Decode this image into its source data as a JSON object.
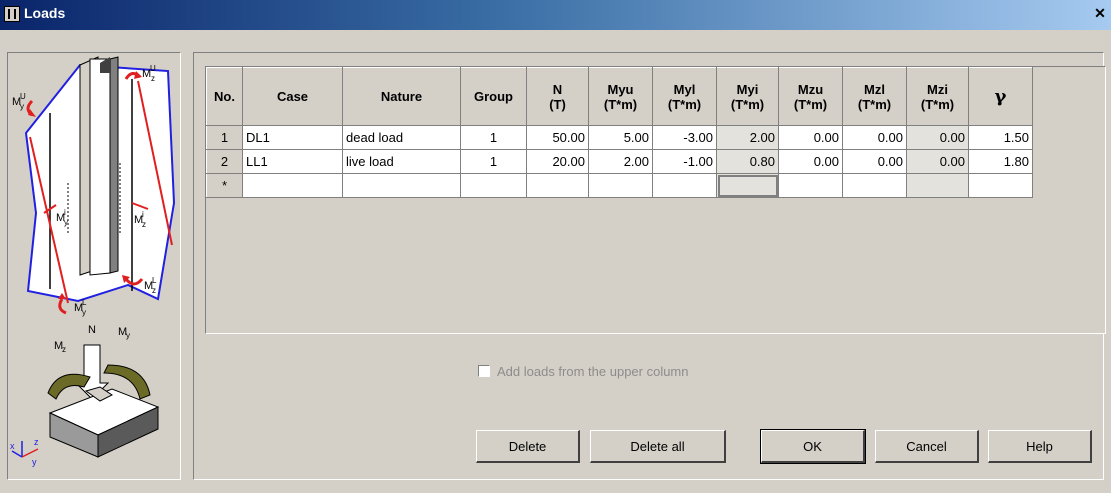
{
  "window": {
    "title": "Loads",
    "close_glyph": "✕"
  },
  "colors": {
    "titlebar_start": "#0a246a",
    "titlebar_end": "#a6caf0",
    "face": "#d4d0c8",
    "calc_cell": "#e4e2dc",
    "red_arrow": "#e02020",
    "figure_blue": "#2020e0"
  },
  "diagram": {
    "label_myu": "Mᵤʸ",
    "label_mzu": "M",
    "label_n": "N",
    "label_my": "My",
    "label_mz": "Mz"
  },
  "grid": {
    "headers": [
      {
        "line1": "No.",
        "line2": ""
      },
      {
        "line1": "Case",
        "line2": ""
      },
      {
        "line1": "Nature",
        "line2": ""
      },
      {
        "line1": "Group",
        "line2": ""
      },
      {
        "line1": "N",
        "line2": "(T)"
      },
      {
        "line1": "Myu",
        "line2": "(T*m)"
      },
      {
        "line1": "Myl",
        "line2": "(T*m)"
      },
      {
        "line1": "Myi",
        "line2": "(T*m)"
      },
      {
        "line1": "Mzu",
        "line2": "(T*m)"
      },
      {
        "line1": "Mzl",
        "line2": "(T*m)"
      },
      {
        "line1": "Mzi",
        "line2": "(T*m)"
      },
      {
        "line1": "γ",
        "line2": ""
      }
    ],
    "rows": [
      {
        "no": "1",
        "case": "DL1",
        "nature": "dead load",
        "group": "1",
        "n": "50.00",
        "myu": "5.00",
        "myl": "-3.00",
        "myi": "2.00",
        "mzu": "0.00",
        "mzl": "0.00",
        "mzi": "0.00",
        "gamma": "1.50"
      },
      {
        "no": "2",
        "case": "LL1",
        "nature": "live load",
        "group": "1",
        "n": "20.00",
        "myu": "2.00",
        "myl": "-1.00",
        "myi": "0.80",
        "mzu": "0.00",
        "mzl": "0.00",
        "mzi": "0.00",
        "gamma": "1.80"
      },
      {
        "no": "*",
        "case": "",
        "nature": "",
        "group": "",
        "n": "",
        "myu": "",
        "myl": "",
        "myi": "",
        "mzu": "",
        "mzl": "",
        "mzi": "",
        "gamma": ""
      }
    ]
  },
  "checkbox": {
    "label": "Add loads from the upper column",
    "checked": false,
    "enabled": false
  },
  "buttons": {
    "delete": "Delete",
    "delete_all": "Delete all",
    "ok": "OK",
    "cancel": "Cancel",
    "help": "Help"
  }
}
